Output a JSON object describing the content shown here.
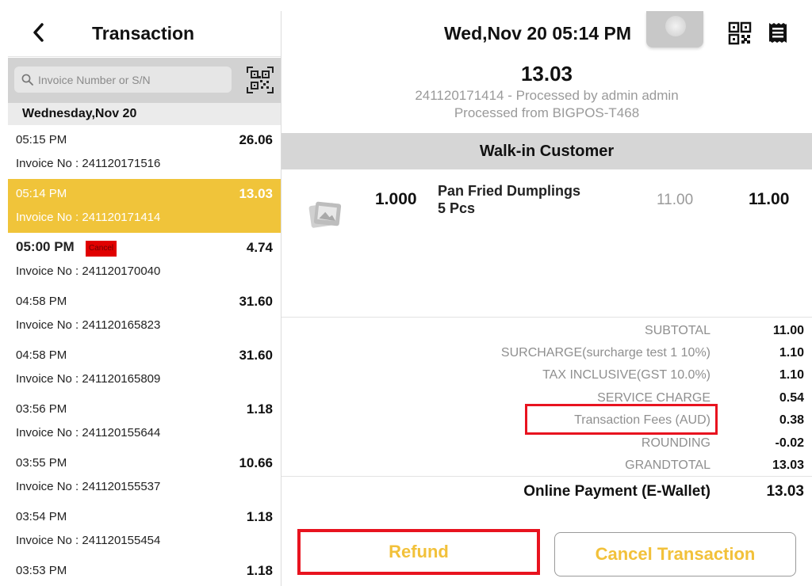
{
  "left_panel": {
    "title": "Transaction",
    "search": {
      "placeholder": "Invoice Number or S/N"
    },
    "date_header": "Wednesday,Nov 20",
    "transactions": [
      {
        "time": "05:15 PM",
        "amount": "26.06",
        "invoice": "Invoice No : 241120171516",
        "selected": false,
        "cancelled": false
      },
      {
        "time": "05:14 PM",
        "amount": "13.03",
        "invoice": "Invoice No : 241120171414",
        "selected": true,
        "cancelled": false
      },
      {
        "time": "05:00 PM",
        "amount": "4.74",
        "invoice": "Invoice No : 241120170040",
        "selected": false,
        "cancelled": true,
        "badge": "Cancel"
      },
      {
        "time": "04:58 PM",
        "amount": "31.60",
        "invoice": "Invoice No : 241120165823",
        "selected": false,
        "cancelled": false
      },
      {
        "time": "04:58 PM",
        "amount": "31.60",
        "invoice": "Invoice No : 241120165809",
        "selected": false,
        "cancelled": false
      },
      {
        "time": "03:56 PM",
        "amount": "1.18",
        "invoice": "Invoice No : 241120155644",
        "selected": false,
        "cancelled": false
      },
      {
        "time": "03:55 PM",
        "amount": "10.66",
        "invoice": "Invoice No : 241120155537",
        "selected": false,
        "cancelled": false
      },
      {
        "time": "03:54 PM",
        "amount": "1.18",
        "invoice": "Invoice No : 241120155454",
        "selected": false,
        "cancelled": false
      },
      {
        "time": "03:53 PM",
        "amount": "1.18",
        "invoice": "",
        "selected": false,
        "cancelled": false
      }
    ]
  },
  "right_panel": {
    "datetime": "Wed,Nov 20 05:14 PM",
    "amount": "13.03",
    "processed_by": "241120171414 - Processed by admin admin",
    "processed_from": "Processed from BIGPOS-T468",
    "customer": "Walk-in Customer",
    "item": {
      "qty": "1.000",
      "name_line1": "Pan Fried Dumplings",
      "name_line2": "5 Pcs",
      "unit_price": "11.00",
      "total": "11.00"
    },
    "summary": [
      {
        "label": "SUBTOTAL",
        "value": "11.00"
      },
      {
        "label": "SURCHARGE(surcharge test 1 10%)",
        "value": "1.10"
      },
      {
        "label": "TAX INCLUSIVE(GST 10.0%)",
        "value": "1.10"
      },
      {
        "label": "SERVICE CHARGE",
        "value": "0.54"
      },
      {
        "label": "Transaction Fees (AUD)",
        "value": "0.38"
      },
      {
        "label": "ROUNDING",
        "value": "-0.02"
      },
      {
        "label": "GRANDTOTAL",
        "value": "13.03"
      }
    ],
    "payment": {
      "label": "Online Payment (E-Wallet)",
      "value": "13.03"
    },
    "refund_label": "Refund",
    "cancel_transaction_label": "Cancel Transaction"
  },
  "colors": {
    "selected_row": "#f0c43a",
    "button_text": "#f2c13a",
    "highlight": "#e8131f",
    "cancel_badge": "#e00000"
  }
}
